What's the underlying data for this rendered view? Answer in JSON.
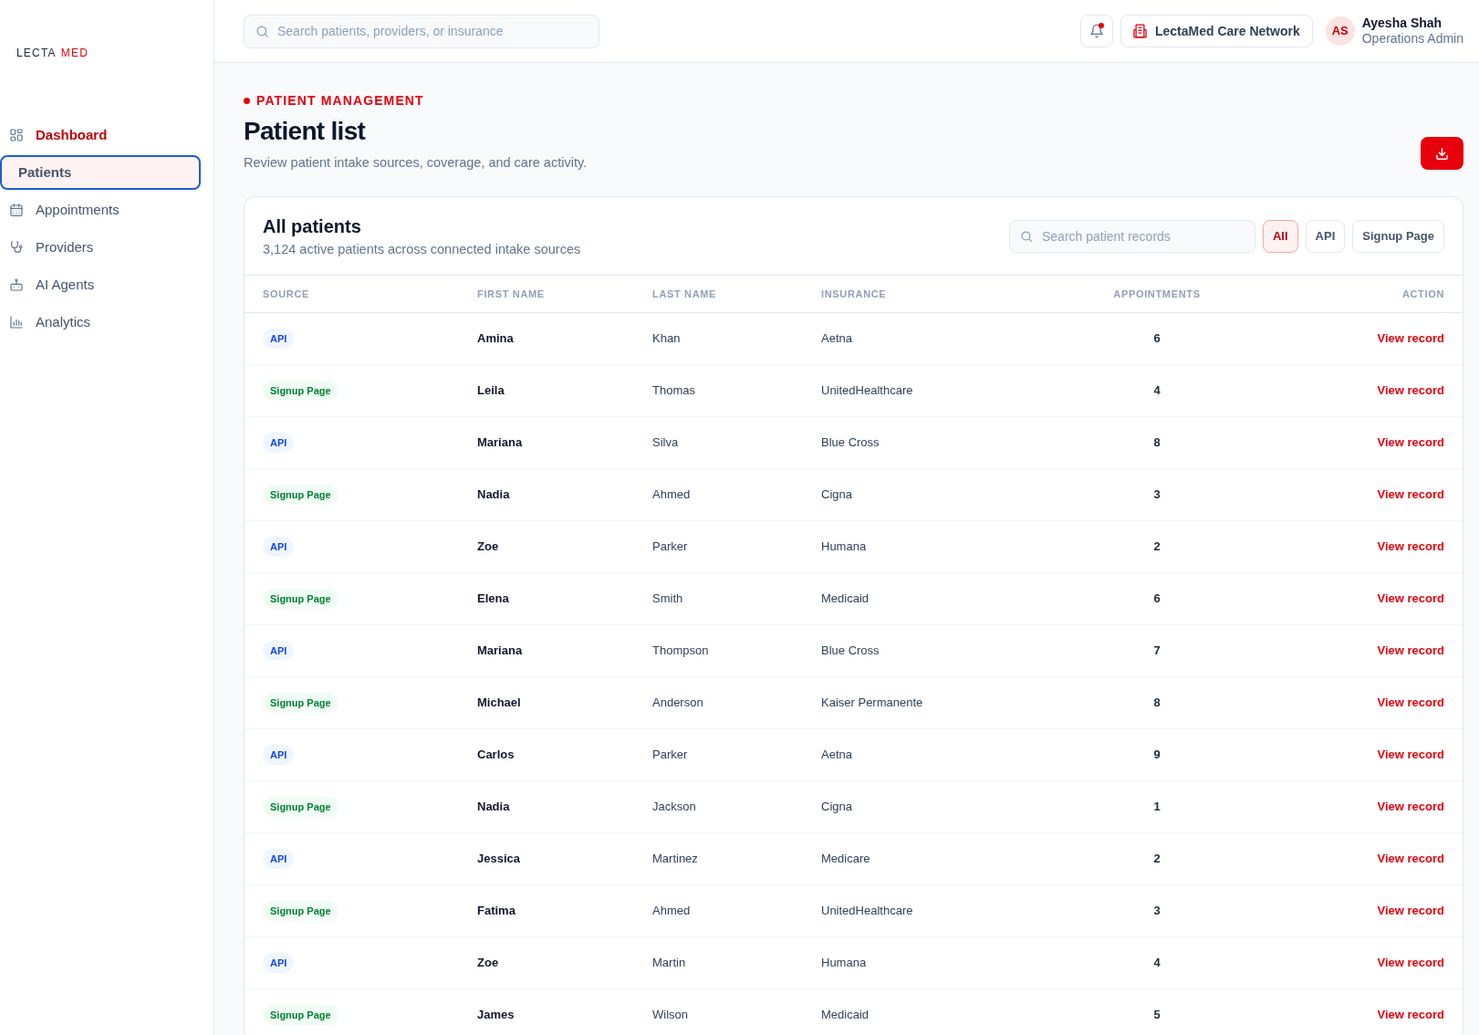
{
  "sidebar": {
    "logo": {
      "part_1": "LECTA",
      "part_2": "MED"
    },
    "nav": [
      {
        "label": "Dashboard",
        "selected": false,
        "current": true
      },
      {
        "label": "Patients",
        "selected": true,
        "current": false
      },
      {
        "label": "Appointments",
        "selected": false,
        "current": false
      },
      {
        "label": "Providers",
        "selected": false,
        "current": false
      },
      {
        "label": "AI Agents",
        "selected": false,
        "current": false
      },
      {
        "label": "Analytics",
        "selected": false,
        "current": false
      }
    ]
  },
  "top_bar": {
    "search": {
      "placeholder": "Search patients, providers, or insurance"
    },
    "notifications": {
      "unread": true
    },
    "organization": "LectaMed Care Network",
    "user": {
      "initials": "AS",
      "name": "Ayesha Shah",
      "role": "Operations Admin"
    }
  },
  "page_header": {
    "eyebrow": "PATIENT MANAGEMENT",
    "title": "Patient list",
    "subtitle": "Review patient intake sources, coverage, and care activity."
  },
  "card": {
    "title": "All patients",
    "subtitle": "3,124 active patients across connected intake sources",
    "search": {
      "placeholder": "Search patient records"
    },
    "filters": [
      {
        "label": "All",
        "selected": true
      },
      {
        "label": "API",
        "selected": false
      },
      {
        "label": "Signup Page",
        "selected": false
      }
    ],
    "table": {
      "columns": [
        "SOURCE",
        "FIRST NAME",
        "LAST NAME",
        "INSURANCE",
        "APPOINTMENTS",
        "ACTION"
      ],
      "rows": [
        {
          "source": {
            "label": "API",
            "kind": "api"
          },
          "first_name": "Amina",
          "last_name": "Khan",
          "insurance": "Aetna",
          "appointments": "6",
          "action": "View record"
        },
        {
          "source": {
            "label": "Signup Page",
            "kind": "signup"
          },
          "first_name": "Leila",
          "last_name": "Thomas",
          "insurance": "UnitedHealthcare",
          "appointments": "4",
          "action": "View record"
        },
        {
          "source": {
            "label": "API",
            "kind": "api"
          },
          "first_name": "Mariana",
          "last_name": "Silva",
          "insurance": "Blue Cross",
          "appointments": "8",
          "action": "View record"
        },
        {
          "source": {
            "label": "Signup Page",
            "kind": "signup"
          },
          "first_name": "Nadia",
          "last_name": "Ahmed",
          "insurance": "Cigna",
          "appointments": "3",
          "action": "View record"
        },
        {
          "source": {
            "label": "API",
            "kind": "api"
          },
          "first_name": "Zoe",
          "last_name": "Parker",
          "insurance": "Humana",
          "appointments": "2",
          "action": "View record"
        },
        {
          "source": {
            "label": "Signup Page",
            "kind": "signup"
          },
          "first_name": "Elena",
          "last_name": "Smith",
          "insurance": "Medicaid",
          "appointments": "6",
          "action": "View record"
        },
        {
          "source": {
            "label": "API",
            "kind": "api"
          },
          "first_name": "Mariana",
          "last_name": "Thompson",
          "insurance": "Blue Cross",
          "appointments": "7",
          "action": "View record"
        },
        {
          "source": {
            "label": "Signup Page",
            "kind": "signup"
          },
          "first_name": "Michael",
          "last_name": "Anderson",
          "insurance": "Kaiser Permanente",
          "appointments": "8",
          "action": "View record"
        },
        {
          "source": {
            "label": "API",
            "kind": "api"
          },
          "first_name": "Carlos",
          "last_name": "Parker",
          "insurance": "Aetna",
          "appointments": "9",
          "action": "View record"
        },
        {
          "source": {
            "label": "Signup Page",
            "kind": "signup"
          },
          "first_name": "Nadia",
          "last_name": "Jackson",
          "insurance": "Cigna",
          "appointments": "1",
          "action": "View record"
        },
        {
          "source": {
            "label": "API",
            "kind": "api"
          },
          "first_name": "Jessica",
          "last_name": "Martinez",
          "insurance": "Medicare",
          "appointments": "2",
          "action": "View record"
        },
        {
          "source": {
            "label": "Signup Page",
            "kind": "signup"
          },
          "first_name": "Fatima",
          "last_name": "Ahmed",
          "insurance": "UnitedHealthcare",
          "appointments": "3",
          "action": "View record"
        },
        {
          "source": {
            "label": "API",
            "kind": "api"
          },
          "first_name": "Zoe",
          "last_name": "Martin",
          "insurance": "Humana",
          "appointments": "4",
          "action": "View record"
        },
        {
          "source": {
            "label": "Signup Page",
            "kind": "signup"
          },
          "first_name": "James",
          "last_name": "Wilson",
          "insurance": "Medicaid",
          "appointments": "5",
          "action": "View record"
        }
      ]
    }
  }
}
